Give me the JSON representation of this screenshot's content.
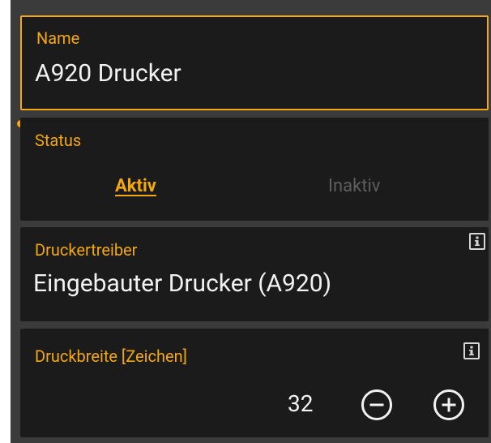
{
  "name_field": {
    "label": "Name",
    "value": "A920 Drucker"
  },
  "status_field": {
    "label": "Status",
    "options": [
      "Aktiv",
      "Inaktiv"
    ],
    "selected": "Aktiv"
  },
  "driver_field": {
    "label": "Druckertreiber",
    "value": "Eingebauter Drucker (A920)",
    "icon": "info-icon"
  },
  "width_field": {
    "label": "Druckbreite [Zeichen]",
    "value": "32",
    "icon": "info-icon",
    "decrement_icon": "minus-circle-icon",
    "increment_icon": "plus-circle-icon"
  },
  "colors": {
    "accent": "#f3a710",
    "card_bg": "#1b1b1b",
    "panel_bg": "#3b3b3b",
    "text": "#f2f2f2",
    "disabled_text": "#5e5e5e"
  }
}
